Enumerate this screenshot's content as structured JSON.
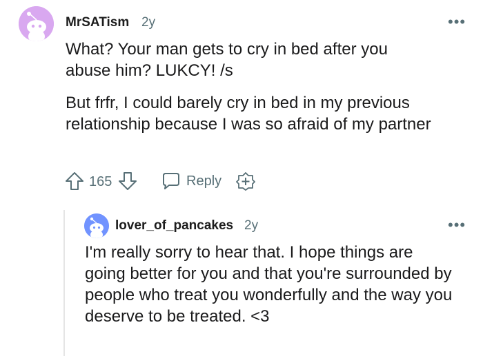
{
  "comment": {
    "username": "MrSATism",
    "age": "2y",
    "more_label": "•••",
    "paragraphs": [
      "What? Your man gets to cry in bed after you abuse him? LUKCY! /s",
      "But frfr, I could barely cry in bed in my previous relationship because I was so afraid of my partner"
    ],
    "vote_count": "165",
    "reply_label": "Reply",
    "avatar_color": "#d9a8f0"
  },
  "reply": {
    "username": "lover_of_pancakes",
    "age": "2y",
    "more_label": "•••",
    "text": "I'm really sorry to hear that. I hope things are going better for you and that you're surrounded by people who treat you wonderfully and the way you deserve to be treated. <3",
    "avatar_color": "#7193ff"
  }
}
